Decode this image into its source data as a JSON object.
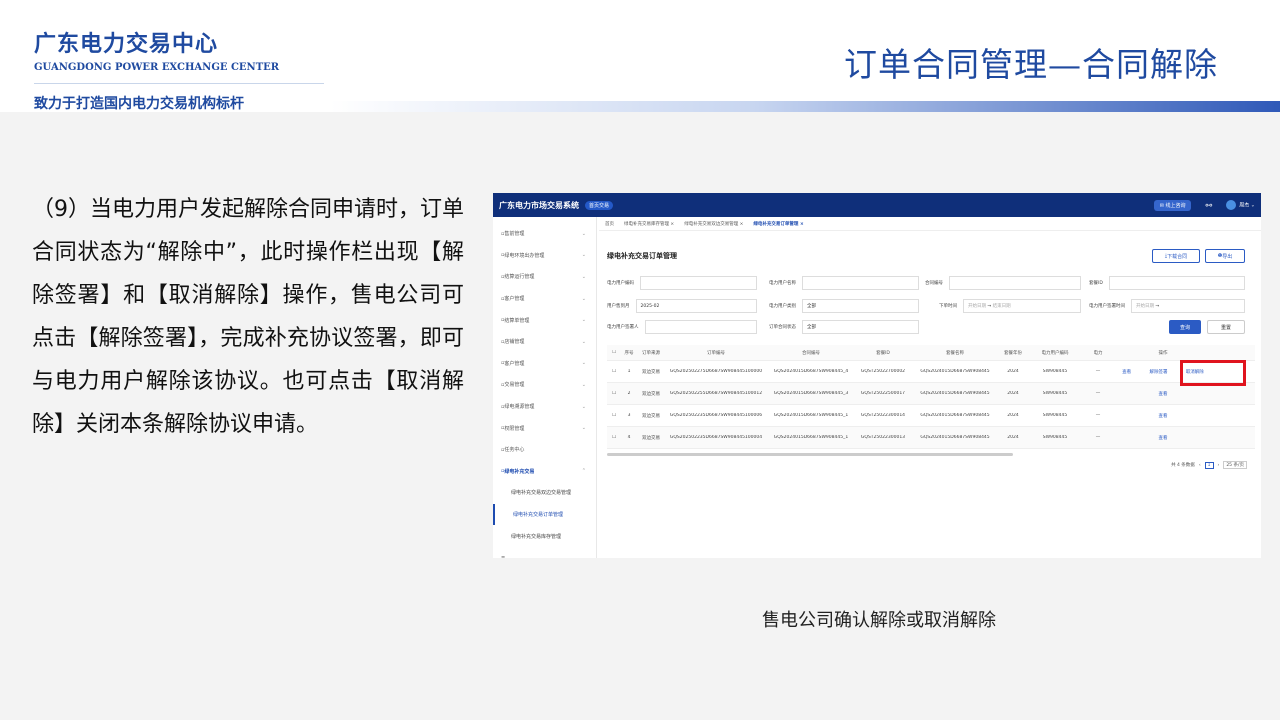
{
  "header": {
    "org_cn": "广东电力交易中心",
    "org_en": "GUANGDONG POWER EXCHANGE CENTER",
    "slogan": "致力于打造国内电力交易机构标杆",
    "title": "订单合同管理—合同解除"
  },
  "description": "（9）当电力用户发起解除合同申请时，订单合同状态为“解除中”，此时操作栏出现【解除签署】和【取消解除】操作，售电公司可点击【解除签署】，完成补充协议签署，即可与电力用户解除该协议。也可点击【取消解除】关闭本条解除协议申请。",
  "caption": "售电公司确认解除或取消解除",
  "screenshot": {
    "brand": "广东电力市场交易系统",
    "chip": "首页交易",
    "online_btn": "线上咨询",
    "user": "周杰",
    "sidebar": [
      "售前管理",
      "绿电环境出办管理",
      "结算运行管理",
      "客户管理",
      "结算单管理",
      "店铺管理",
      "客户管理",
      "交易管理",
      "绿电溯源管理",
      "权限管理",
      "任务中心",
      "绿电补充交易"
    ],
    "submenu": [
      "绿电补充交易双边交易管理",
      "绿电补充交易订单管理",
      "绿电补充交易库存管理"
    ],
    "tabs": [
      "首页",
      "绿电补充交易库存管理 ×",
      "绿电补充交易双边交易管理 ×",
      "绿电补充交易订单管理 ×"
    ],
    "title": "绿电补充交易订单管理",
    "download_btn": "下载合同",
    "export_btn": "导出",
    "filters": {
      "user_code": "电力用户编码",
      "user_name": "电力用户名称",
      "contract_no": "合同编号",
      "cert_id": "套餐ID",
      "month_label": "用户售到月",
      "month_value": "2025-02",
      "user_type_label": "电力用户类别",
      "user_type_value": "全部",
      "order_time": "下单时间",
      "start": "开始日期",
      "end": "结束日期",
      "sign_time": "电力用户签署时间",
      "signer": "电力用户签署人",
      "status_label": "订单合同状态",
      "status_value": "全部"
    },
    "query_btn": "查询",
    "reset_btn": "重置",
    "columns": [
      "序号",
      "订单来源",
      "订单编号",
      "合同编号",
      "套餐ID",
      "套餐名称",
      "套餐年份",
      "电力用户编码",
      "电力",
      "操作"
    ],
    "rows": [
      {
        "no": "1",
        "src": "双边交易",
        "order": "GQS202502275D6687SW908445100000",
        "contract": "GQS2024015D6687SW908445_4",
        "pkg": "GQST25022700002",
        "name": "GQS2024015D6687SW908445",
        "year": "2024",
        "code": "SW908445",
        "ops": [
          "查看",
          "解除签署",
          "取消解除"
        ]
      },
      {
        "no": "2",
        "src": "双边交易",
        "order": "GQS202502255D6687SW908445100012",
        "contract": "GQS2024015D6687SW908445_3",
        "pkg": "GQST25022500017",
        "name": "GQS2024015D6687SW908445",
        "year": "2024",
        "code": "SW908445",
        "ops": [
          "查看"
        ]
      },
      {
        "no": "3",
        "src": "双边交易",
        "order": "GQS202502235D6687SW908445100006",
        "contract": "GQS2024015D6687SW908445_1",
        "pkg": "GQST25022300014",
        "name": "GQS2024015D6687SW908445",
        "year": "2024",
        "code": "SW908445",
        "ops": [
          "查看"
        ]
      },
      {
        "no": "4",
        "src": "双边交易",
        "order": "GQS202502235D6687SW908445100004",
        "contract": "GQS2024015D6687SW908445_1",
        "pkg": "GQST25022300013",
        "name": "GQS2024015D6687SW908445",
        "year": "2024",
        "code": "SW908445",
        "ops": [
          "查看"
        ]
      }
    ],
    "pager": {
      "total": "共 4 条数据",
      "page": "1",
      "size": "25 条/页"
    }
  }
}
